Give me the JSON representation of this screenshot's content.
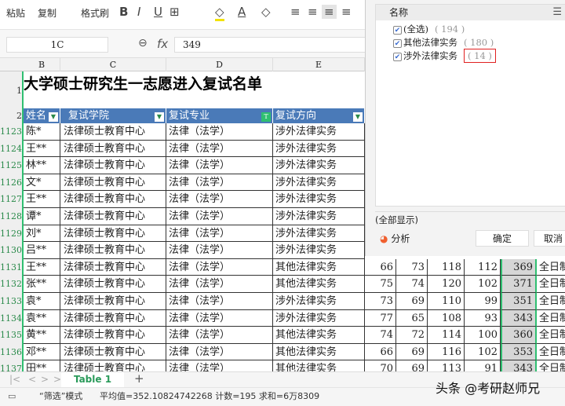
{
  "toolbar": {
    "paste": "粘贴",
    "copy": "复制",
    "format_painter": "格式刷",
    "bold": "B",
    "italic": "I",
    "underline": "U",
    "borders": "⊞",
    "fill": "◇",
    "font_color": "A",
    "clear": "◇"
  },
  "formula_bar": {
    "name_box": "1C",
    "fx": "fx",
    "value": "349"
  },
  "columns": [
    "B",
    "C",
    "D",
    "E"
  ],
  "sheet": {
    "title": "大学硕士研究生一志愿进入复试名单",
    "row_labels": {
      "title": "1",
      "header": "2"
    },
    "headers": [
      "姓名",
      "复试学院",
      "复试专业",
      "复试方向"
    ],
    "rows": [
      {
        "num": "1123",
        "name": "陈*",
        "college": "法律硕士教育中心",
        "major": "法律（法学）",
        "direction": "涉外法律实务",
        "scores": []
      },
      {
        "num": "1124",
        "name": "王**",
        "college": "法律硕士教育中心",
        "major": "法律（法学）",
        "direction": "涉外法律实务",
        "scores": []
      },
      {
        "num": "1125",
        "name": "林**",
        "college": "法律硕士教育中心",
        "major": "法律（法学）",
        "direction": "涉外法律实务",
        "scores": []
      },
      {
        "num": "1126",
        "name": "文*",
        "college": "法律硕士教育中心",
        "major": "法律（法学）",
        "direction": "涉外法律实务",
        "scores": []
      },
      {
        "num": "1127",
        "name": "王**",
        "college": "法律硕士教育中心",
        "major": "法律（法学）",
        "direction": "涉外法律实务",
        "scores": []
      },
      {
        "num": "1128",
        "name": "谭*",
        "college": "法律硕士教育中心",
        "major": "法律（法学）",
        "direction": "涉外法律实务",
        "scores": []
      },
      {
        "num": "1129",
        "name": "刘*",
        "college": "法律硕士教育中心",
        "major": "法律（法学）",
        "direction": "涉外法律实务",
        "scores": []
      },
      {
        "num": "1130",
        "name": "吕**",
        "college": "法律硕士教育中心",
        "major": "法律（法学）",
        "direction": "涉外法律实务",
        "scores": []
      },
      {
        "num": "1131",
        "name": "王**",
        "college": "法律硕士教育中心",
        "major": "法律（法学）",
        "direction": "其他法律实务",
        "scores": [
          "66",
          "73",
          "118",
          "112",
          "369"
        ],
        "type": "全日制"
      },
      {
        "num": "1132",
        "name": "张**",
        "college": "法律硕士教育中心",
        "major": "法律（法学）",
        "direction": "其他法律实务",
        "scores": [
          "75",
          "74",
          "120",
          "102",
          "371"
        ],
        "type": "全日制"
      },
      {
        "num": "1133",
        "name": "袁*",
        "college": "法律硕士教育中心",
        "major": "法律（法学）",
        "direction": "涉外法律实务",
        "scores": [
          "73",
          "69",
          "110",
          "99",
          "351"
        ],
        "type": "全日制"
      },
      {
        "num": "1134",
        "name": "袁**",
        "college": "法律硕士教育中心",
        "major": "法律（法学）",
        "direction": "涉外法律实务",
        "scores": [
          "77",
          "65",
          "108",
          "93",
          "343"
        ],
        "type": "全日制"
      },
      {
        "num": "1135",
        "name": "黄**",
        "college": "法律硕士教育中心",
        "major": "法律（法学）",
        "direction": "其他法律实务",
        "scores": [
          "74",
          "72",
          "114",
          "100",
          "360"
        ],
        "type": "全日制"
      },
      {
        "num": "1136",
        "name": "邓**",
        "college": "法律硕士教育中心",
        "major": "法律（法学）",
        "direction": "其他法律实务",
        "scores": [
          "66",
          "69",
          "116",
          "102",
          "353"
        ],
        "type": "全日制"
      },
      {
        "num": "1137",
        "name": "田**",
        "college": "法律硕士教育中心",
        "major": "法律（法学）",
        "direction": "其他法律实务",
        "scores": [
          "70",
          "69",
          "113",
          "91",
          "343"
        ],
        "type": "全日制"
      }
    ]
  },
  "filter_panel": {
    "header": "名称",
    "items": [
      {
        "label": "(全选)",
        "count": "( 194 )",
        "checked": true
      },
      {
        "label": "其他法律实务",
        "count": "( 180 )",
        "checked": true
      },
      {
        "label": "涉外法律实务",
        "count": "( 14 )",
        "checked": true,
        "highlighted": true
      }
    ],
    "show_all": "(全部显示)",
    "analyze": "分析",
    "ok": "确定",
    "cancel": "取消"
  },
  "tabs": {
    "active": "Table 1",
    "add": "+"
  },
  "status": {
    "mode": "“筛选”模式",
    "stats": "平均值=352.10824742268  计数=195  求和=6万8309"
  },
  "watermark": "头条 @考研赵师兄",
  "colors": {
    "header_blue": "#4a7ab8",
    "accent_green": "#2fbf71",
    "highlight_red": "#e02020"
  }
}
